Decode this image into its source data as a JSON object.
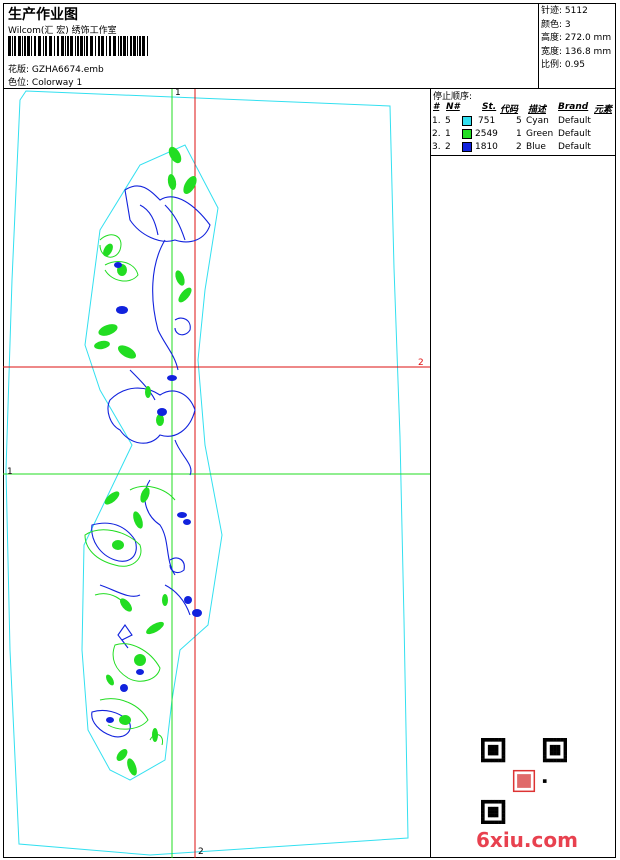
{
  "header": {
    "title": "生产作业图",
    "studio": "Wilcom(汇 宏) 绣饰工作室",
    "design_label": "花版:",
    "design_file": "GZHA6674.emb",
    "colorway_label": "色位:",
    "colorway": "Colorway 1"
  },
  "stats": {
    "stitches_label": "针迹:",
    "stitches": "5112",
    "colors_label": "颜色:",
    "colors": "3",
    "height_label": "高度:",
    "height": "272.0 mm",
    "width_label": "宽度:",
    "width": "136.8 mm",
    "scale_label": "比例:",
    "scale": "0.95"
  },
  "stop_sequence": {
    "title": "停止顺序:",
    "headers": [
      "#",
      "N#",
      "St.",
      "代码",
      "描述",
      "Brand",
      "元素"
    ],
    "rows": [
      {
        "idx": "1.",
        "n": "5",
        "color": "#33e0f0",
        "st": "751",
        "code": "5",
        "desc": "Cyan",
        "brand": "Default"
      },
      {
        "idx": "2.",
        "n": "1",
        "color": "#22dd22",
        "st": "2549",
        "code": "1",
        "desc": "Green",
        "brand": "Default"
      },
      {
        "idx": "3.",
        "n": "2",
        "color": "#1122dd",
        "st": "1810",
        "code": "2",
        "desc": "Blue",
        "brand": "Default"
      }
    ]
  },
  "axes": {
    "green_v_top": "1",
    "green_h_left": "1",
    "red_h_right": "2",
    "red_v_bottom": "2"
  },
  "watermark": "6xiu.com",
  "colors": {
    "cyan": "#33e0f0",
    "green": "#22dd22",
    "blue": "#1122dd",
    "red": "#dd1111"
  }
}
